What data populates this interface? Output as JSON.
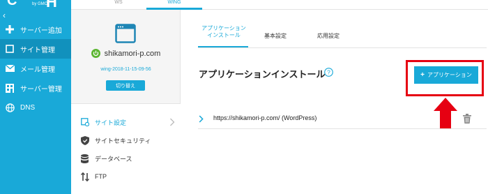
{
  "header": {
    "logo_text": "C",
    "logo_sub": "by GMO",
    "logo_tail": "H",
    "tabs": [
      {
        "label": "WS"
      },
      {
        "label": "WING"
      }
    ]
  },
  "sidebar": {
    "items": [
      {
        "label": "サーバー追加",
        "icon": "plus-icon"
      },
      {
        "label": "サイト管理",
        "icon": "site-icon"
      },
      {
        "label": "メール管理",
        "icon": "mail-icon"
      },
      {
        "label": "サーバー管理",
        "icon": "server-icon"
      },
      {
        "label": "DNS",
        "icon": "globe-icon"
      }
    ]
  },
  "site": {
    "name": "shikamori-p.com",
    "id": "wing-2018-11-15-09-56",
    "switch_label": "切り替え"
  },
  "subnav": {
    "items": [
      {
        "label": "サイト設定",
        "icon": "site-settings-icon"
      },
      {
        "label": "サイトセキュリティ",
        "icon": "shield-icon"
      },
      {
        "label": "データベース",
        "icon": "database-icon"
      },
      {
        "label": "FTP",
        "icon": "transfer-icon"
      }
    ]
  },
  "main": {
    "tabs": [
      {
        "line1": "アプリケーション",
        "line2": "インストール"
      },
      {
        "line1": "基本設定",
        "line2": ""
      },
      {
        "line1": "応用設定",
        "line2": ""
      }
    ],
    "title": "アプリケーションインストール",
    "add_button_label": "アプリケーション",
    "installed": [
      {
        "text": "https://shikamori-p.com/ (WordPress)"
      }
    ]
  },
  "colors": {
    "brand": "#19a9d8",
    "brand_dark": "#1191bd",
    "highlight": "#e60012"
  }
}
